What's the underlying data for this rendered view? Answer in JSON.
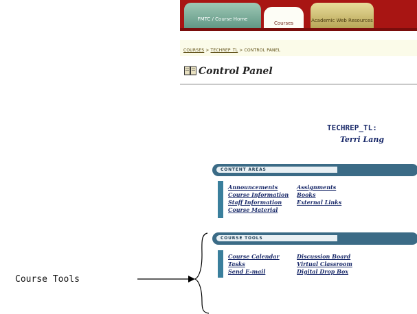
{
  "tabs": [
    {
      "label": "FMTC / Course Home"
    },
    {
      "label": "Courses"
    },
    {
      "label": "Academic Web Resources"
    }
  ],
  "breadcrumb": {
    "items": [
      "COURSES",
      "TECHREP_TL",
      "CONTROL PANEL"
    ],
    "separator": ">"
  },
  "page": {
    "title": "Control Panel",
    "course_id": "TECHREP_TL:",
    "instructor": "Terri Lang"
  },
  "sections": [
    {
      "title": "CONTENT AREAS",
      "links": [
        [
          "Announcements",
          "Assignments"
        ],
        [
          "Course Information",
          "Books"
        ],
        [
          "Staff Information",
          "External Links"
        ],
        [
          "Course Material",
          ""
        ]
      ]
    },
    {
      "title": "COURSE TOOLS",
      "links": [
        [
          "Course Calendar",
          "Discussion Board"
        ],
        [
          "Tasks",
          "Virtual Classroom"
        ],
        [
          "Send E-mail",
          "Digital Drop Box"
        ]
      ]
    }
  ],
  "annotation": {
    "label": "Course Tools"
  },
  "colors": {
    "tab_bar": "#a81513",
    "pill": "#3b6b86",
    "panel_border": "#3a7f9c",
    "link": "#1a2a6a"
  }
}
